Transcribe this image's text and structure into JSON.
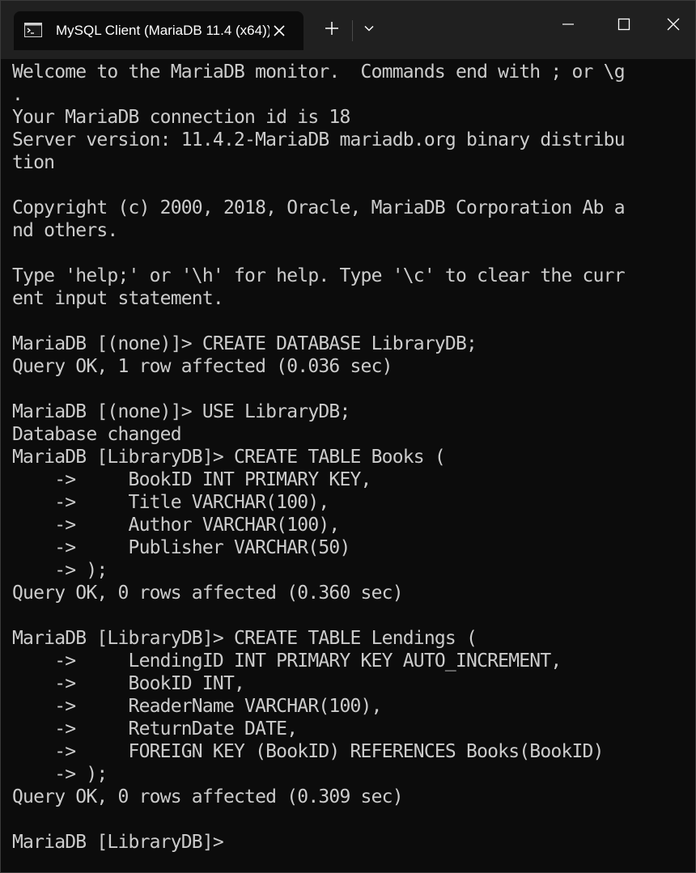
{
  "window": {
    "tab_title": "MySQL Client (MariaDB 11.4 (x64))",
    "tab_icon": "terminal-icon",
    "new_tab_icon": "plus-icon",
    "dropdown_icon": "chevron-down-icon",
    "minimize_icon": "minimize-icon",
    "maximize_icon": "maximize-icon",
    "close_icon": "close-icon"
  },
  "terminal": {
    "lines": [
      "Welcome to the MariaDB monitor.  Commands end with ; or \\g",
      ".",
      "Your MariaDB connection id is 18",
      "Server version: 11.4.2-MariaDB mariadb.org binary distribu",
      "tion",
      "",
      "Copyright (c) 2000, 2018, Oracle, MariaDB Corporation Ab a",
      "nd others.",
      "",
      "Type 'help;' or '\\h' for help. Type '\\c' to clear the curr",
      "ent input statement.",
      "",
      "MariaDB [(none)]> CREATE DATABASE LibraryDB;",
      "Query OK, 1 row affected (0.036 sec)",
      "",
      "MariaDB [(none)]> USE LibraryDB;",
      "Database changed",
      "MariaDB [LibraryDB]> CREATE TABLE Books (",
      "    ->     BookID INT PRIMARY KEY,",
      "    ->     Title VARCHAR(100),",
      "    ->     Author VARCHAR(100),",
      "    ->     Publisher VARCHAR(50)",
      "    -> );",
      "Query OK, 0 rows affected (0.360 sec)",
      "",
      "MariaDB [LibraryDB]> CREATE TABLE Lendings (",
      "    ->     LendingID INT PRIMARY KEY AUTO_INCREMENT,",
      "    ->     BookID INT,",
      "    ->     ReaderName VARCHAR(100),",
      "    ->     ReturnDate DATE,",
      "    ->     FOREIGN KEY (BookID) REFERENCES Books(BookID)",
      "    -> );",
      "Query OK, 0 rows affected (0.309 sec)",
      "",
      "MariaDB [LibraryDB]>"
    ]
  }
}
